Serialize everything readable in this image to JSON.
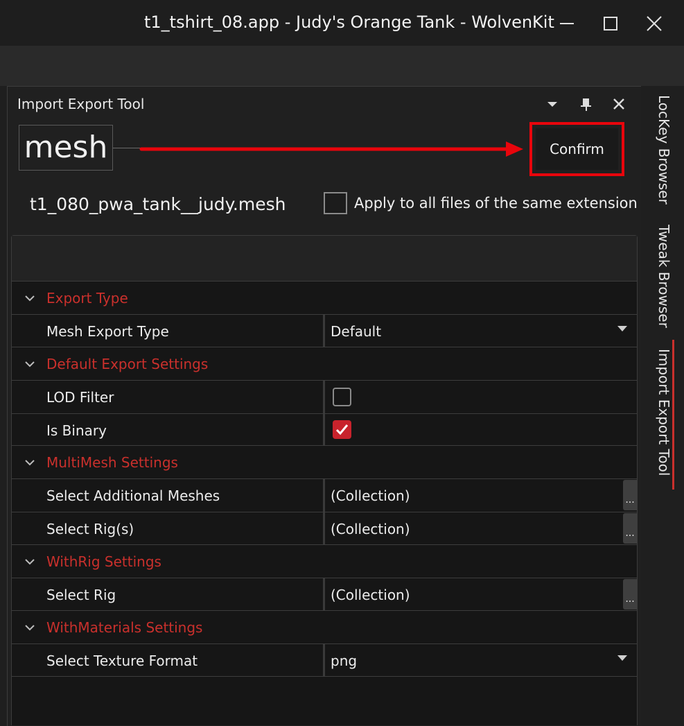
{
  "window": {
    "title": "t1_tshirt_08.app - Judy's Orange Tank - WolvenKit",
    "minimize_icon": "minimize-icon",
    "maximize_icon": "maximize-icon",
    "close_icon": "close-icon"
  },
  "panel": {
    "title": "Import Export Tool",
    "dropdown_icon": "dropdown-icon",
    "pin_icon": "pin-icon",
    "close_icon": "close-icon"
  },
  "extension_label": "mesh",
  "confirm_label": "Confirm",
  "file_name": "t1_080_pwa_tank__judy.mesh",
  "apply_all": {
    "label": "Apply to all files of the same extension",
    "checked": false
  },
  "grid": {
    "categories": {
      "export_type": "Export Type",
      "default_export": "Default Export Settings",
      "multimesh": "MultiMesh Settings",
      "withrig": "WithRig Settings",
      "withmaterials": "WithMaterials Settings"
    },
    "properties": {
      "mesh_export_type": {
        "name": "Mesh Export Type",
        "value": "Default"
      },
      "lod_filter": {
        "name": "LOD Filter",
        "checked": false
      },
      "is_binary": {
        "name": "Is Binary",
        "checked": true
      },
      "select_additional_meshes": {
        "name": "Select Additional Meshes",
        "value": "(Collection)",
        "button": "..."
      },
      "select_rigs": {
        "name": "Select Rig(s)",
        "value": "(Collection)",
        "button": "..."
      },
      "select_rig": {
        "name": "Select Rig",
        "value": "(Collection)",
        "button": "..."
      },
      "select_texture_format": {
        "name": "Select Texture Format",
        "value": "png"
      }
    }
  },
  "side_tabs": [
    "LocKey Browser",
    "Tweak Browser",
    "Import Export Tool"
  ],
  "colors": {
    "accent_red": "#c9302c",
    "highlight_red": "#e8050c",
    "checkbox_checked": "#c8232c"
  }
}
